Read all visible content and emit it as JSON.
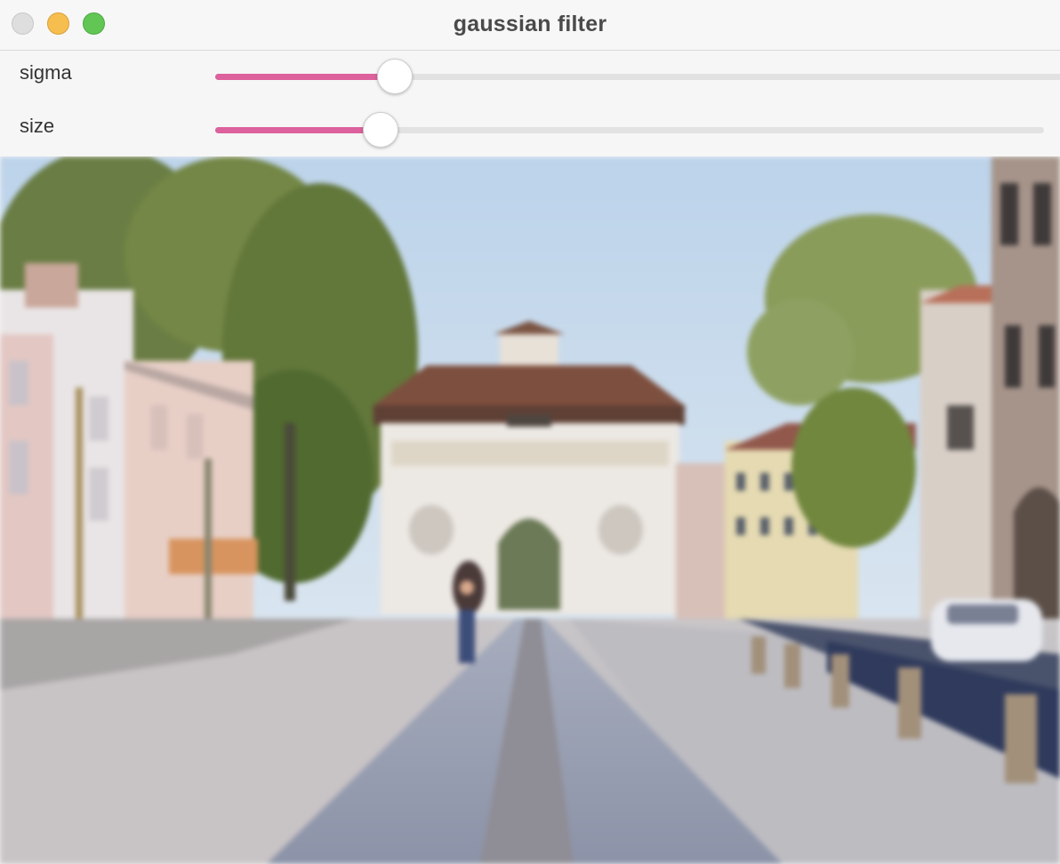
{
  "window": {
    "title": "gaussian filter"
  },
  "controls": {
    "sigma": {
      "label": "sigma",
      "fraction": 0.21,
      "fill_color": "#dc619c"
    },
    "size": {
      "label": "size",
      "fraction": 0.2,
      "fill_color": "#dc619c"
    }
  },
  "image": {
    "description_icon": "photo-blurred-street-city-gate"
  }
}
